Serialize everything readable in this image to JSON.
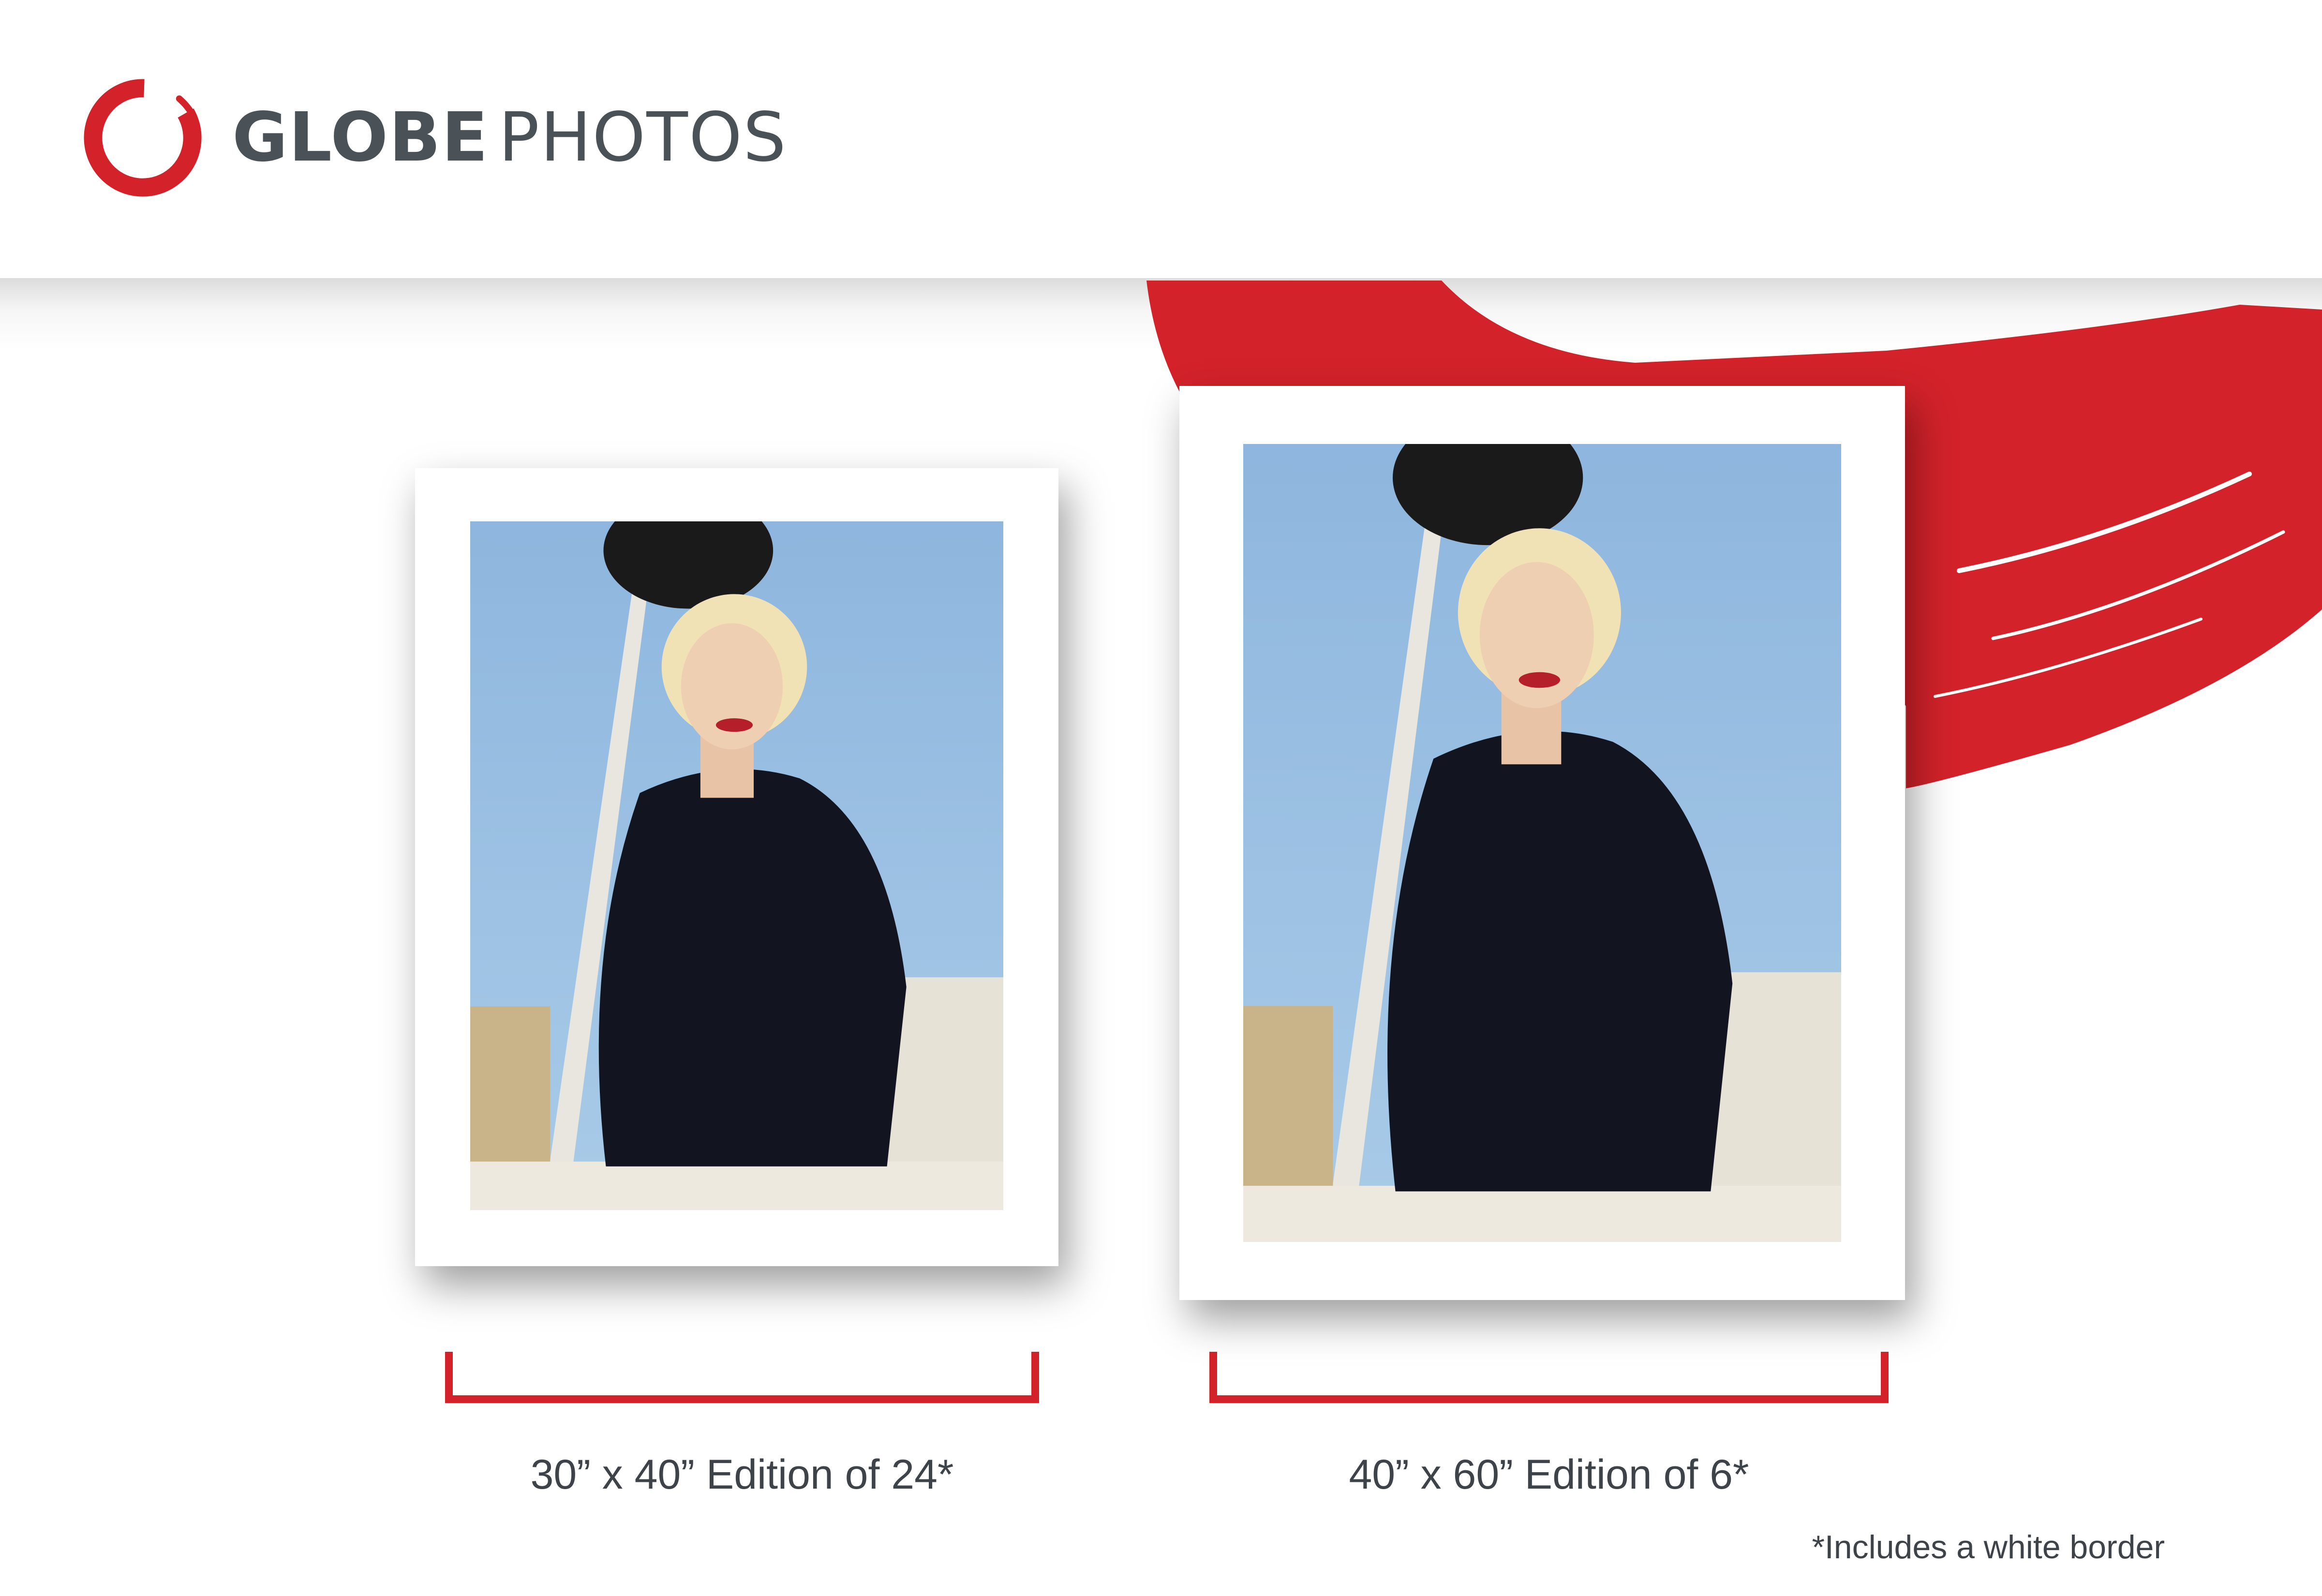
{
  "brand": {
    "name_bold": "GLOBE",
    "name_light": "PHOTOS",
    "logo_icon": "red-brush-ring-icon"
  },
  "colors": {
    "accent_red": "#d3222a",
    "text_gray": "#3d4348",
    "brand_gray": "#4a5257"
  },
  "prints": [
    {
      "label": "30” x 40” Edition of 24*"
    },
    {
      "label": "40” x 60” Edition of 6*"
    }
  ],
  "footnote": "*Includes a white border"
}
